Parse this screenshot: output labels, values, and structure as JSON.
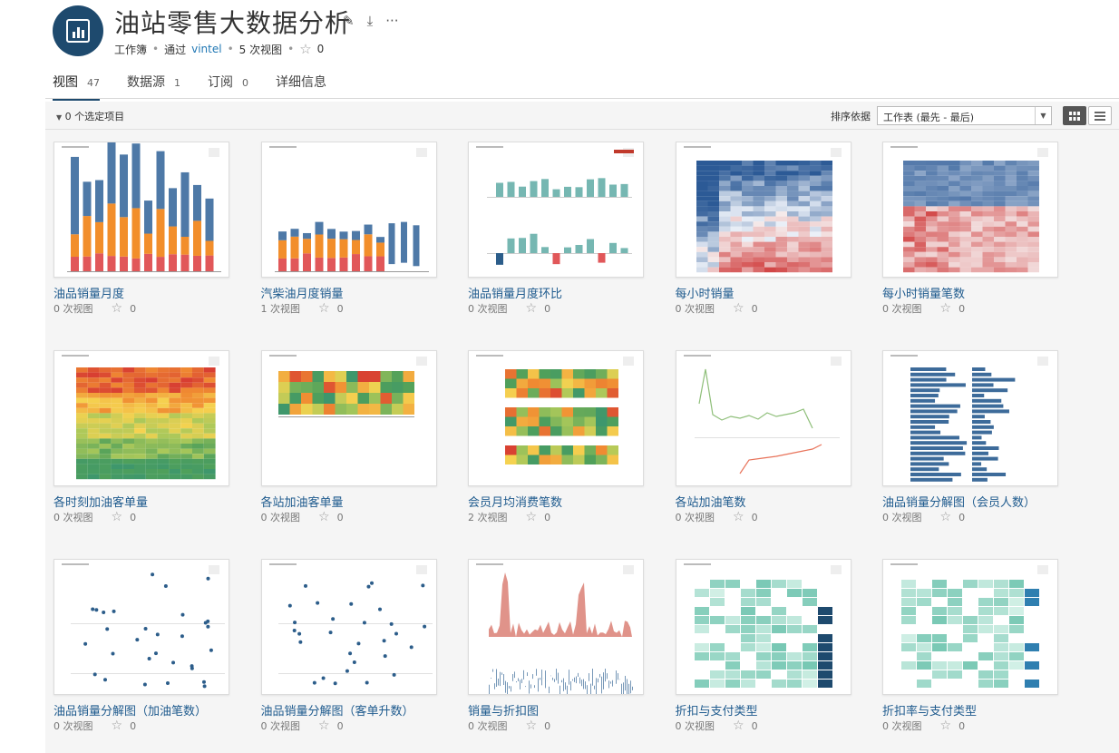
{
  "workbook": {
    "title": "油站零售大数据分析",
    "type_label": "工作簿",
    "via_label": "通过",
    "owner": "vintel",
    "views_label": "5 次视图",
    "favorites": "0",
    "actions": {
      "edit_icon": "pencil-icon",
      "download_icon": "download-icon",
      "more": "···"
    }
  },
  "tabs": [
    {
      "label": "视图",
      "count": "47",
      "active": true
    },
    {
      "label": "数据源",
      "count": "1"
    },
    {
      "label": "订阅",
      "count": "0"
    },
    {
      "label": "详细信息",
      "count": ""
    }
  ],
  "toolbar": {
    "selected_label": "0 个选定项目",
    "sort_label": "排序依据",
    "sort_value": "工作表 (最先 - 最后)"
  },
  "views": [
    {
      "title": "油品销量月度",
      "views": "0 次视图",
      "favorites": "0",
      "thumb": "stacked-bar"
    },
    {
      "title": "汽柴油月度销量",
      "views": "1 次视图",
      "favorites": "0",
      "thumb": "stacked-bar-2"
    },
    {
      "title": "油品销量月度环比",
      "views": "0 次视图",
      "favorites": "0",
      "thumb": "diverging-bar"
    },
    {
      "title": "每小时销量",
      "views": "0 次视图",
      "favorites": "0",
      "thumb": "heatmap-blue-red"
    },
    {
      "title": "每小时销量笔数",
      "views": "0 次视图",
      "favorites": "0",
      "thumb": "heatmap-blue-red-2"
    },
    {
      "title": "各时刻加油客单量",
      "views": "0 次视图",
      "favorites": "0",
      "thumb": "heatmap-rainbow"
    },
    {
      "title": "各站加油客单量",
      "views": "0 次视图",
      "favorites": "0",
      "thumb": "heatmap-rainbow-2"
    },
    {
      "title": "会员月均消费笔数",
      "views": "2 次视图",
      "favorites": "0",
      "thumb": "heatmap-rainbow-3"
    },
    {
      "title": "各站加油笔数",
      "views": "0 次视图",
      "favorites": "0",
      "thumb": "line"
    },
    {
      "title": "油品销量分解图（会员人数）",
      "views": "0 次视图",
      "favorites": "0",
      "thumb": "hbar"
    },
    {
      "title": "油品销量分解图（加油笔数）",
      "views": "0 次视图",
      "favorites": "0",
      "thumb": "dots"
    },
    {
      "title": "油品销量分解图（客单升数）",
      "views": "0 次视图",
      "favorites": "0",
      "thumb": "dots-2"
    },
    {
      "title": "销量与折扣图",
      "views": "0 次视图",
      "favorites": "0",
      "thumb": "area"
    },
    {
      "title": "折扣与支付类型",
      "views": "0 次视图",
      "favorites": "0",
      "thumb": "table-teal"
    },
    {
      "title": "折扣率与支付类型",
      "views": "0 次视图",
      "favorites": "0",
      "thumb": "table-teal-2"
    }
  ],
  "colors": {
    "accent": "#1e4a6e",
    "link": "#1f5b8e",
    "blue": "#4e79a7",
    "orange": "#f28e2b",
    "red": "#e15759",
    "teal": "#76b7b2"
  }
}
